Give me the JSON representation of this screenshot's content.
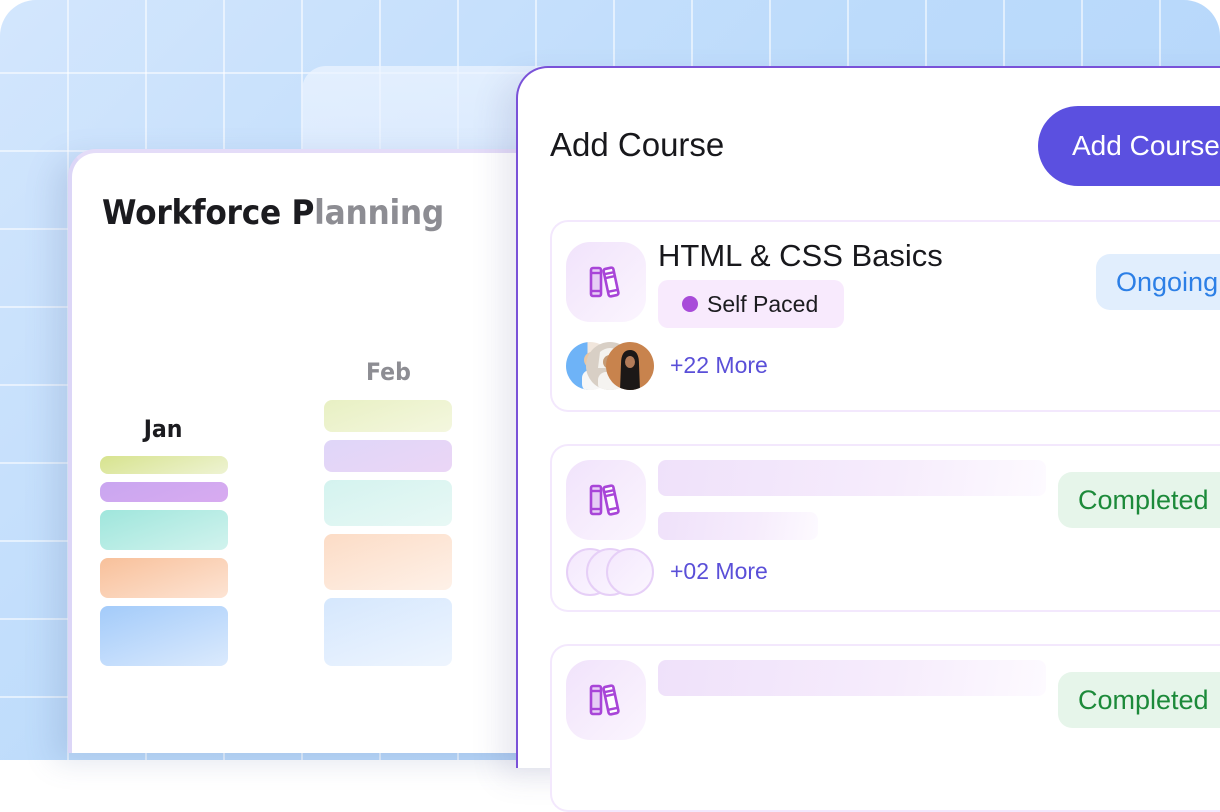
{
  "workforce": {
    "title_dark": "Workforce P",
    "title_faded": "lanning",
    "months": [
      {
        "label": "Jan",
        "bars": [
          {
            "color_from": "#d7e38e",
            "color_to": "#eef3d3"
          },
          {
            "color_from": "#c9a6f0",
            "color_to": "#d8abf0"
          },
          {
            "color_from": "#9fe6dc",
            "color_to": "#d2f3ee"
          },
          {
            "color_from": "#f8c09a",
            "color_to": "#fde4d4"
          },
          {
            "color_from": "#a3cbfa",
            "color_to": "#dbeafd"
          }
        ]
      },
      {
        "label": "Feb",
        "bars": [
          {
            "color_from": "#e8f0c3",
            "color_to": "#f4f7df"
          },
          {
            "color_from": "#dfd6f8",
            "color_to": "#ebd6f6"
          },
          {
            "color_from": "#d4f3ef",
            "color_to": "#e8f8f5"
          },
          {
            "color_from": "#fcdcc6",
            "color_to": "#fef1e8"
          },
          {
            "color_from": "#d5e7fd",
            "color_to": "#eef5fe"
          }
        ]
      }
    ]
  },
  "panel": {
    "title": "Add Course",
    "add_button_label": "Add Course",
    "accent": "#5b50e0",
    "courses": [
      {
        "title": "HTML & CSS Basics",
        "badge": "Self Paced",
        "status": "Ongoing",
        "more": "+22 More",
        "icon": "books-icon"
      },
      {
        "title": "",
        "badge": "",
        "status": "Completed",
        "more": "+02 More",
        "icon": "books-icon"
      },
      {
        "title": "",
        "badge": "",
        "status": "Completed",
        "more": "",
        "icon": "books-icon"
      }
    ]
  },
  "colors": {
    "ongoing_text": "#2c7fe6",
    "ongoing_bg": "#e1eefd",
    "completed_text": "#1c8a3a",
    "completed_bg": "#e6f5ea",
    "self_paced_dot": "#a84bd9",
    "more_link": "#5a4fd8"
  }
}
